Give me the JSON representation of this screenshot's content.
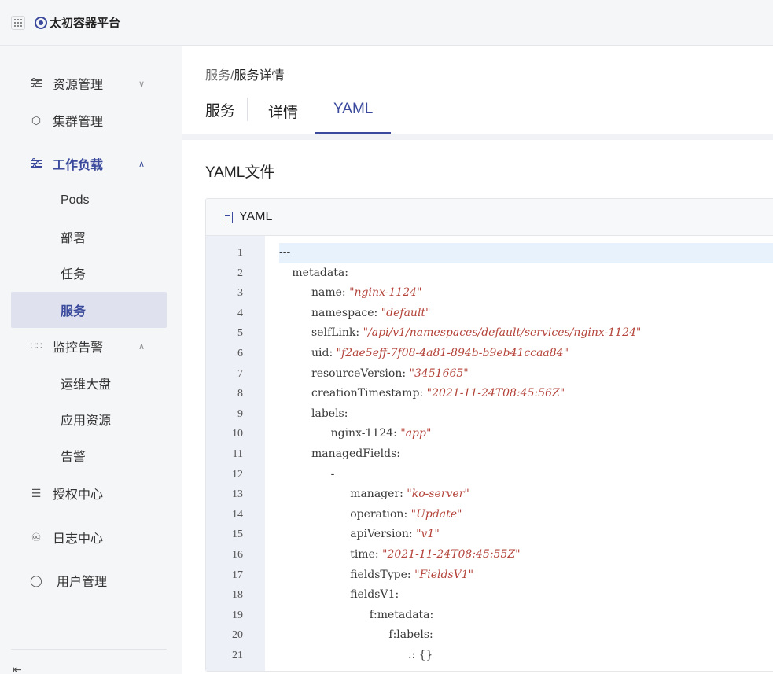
{
  "app": {
    "title": "太初容器平台"
  },
  "sidebar": {
    "items": [
      {
        "label": "资源管理",
        "icon": "sliders-icon",
        "expanded": false
      },
      {
        "label": "集群管理",
        "icon": "cluster-icon"
      },
      {
        "label": "工作负载",
        "icon": "sliders-icon",
        "expanded": true,
        "children": [
          {
            "label": "Pods"
          },
          {
            "label": "部署"
          },
          {
            "label": "任务"
          },
          {
            "label": "服务",
            "active": true
          }
        ]
      },
      {
        "label": "监控告警",
        "icon": "apps-icon",
        "expanded": true,
        "children": [
          {
            "label": "运维大盘"
          },
          {
            "label": "应用资源"
          },
          {
            "label": "告警"
          }
        ]
      },
      {
        "label": "授权中心",
        "icon": "list-icon"
      },
      {
        "label": "日志中心",
        "icon": "bell-icon"
      },
      {
        "label": "用户管理",
        "icon": "user-icon"
      }
    ]
  },
  "breadcrumb": {
    "parent": "服务",
    "separator": "/",
    "current": "服务详情"
  },
  "tabs": {
    "title": "服务",
    "items": [
      {
        "label": "详情"
      },
      {
        "label": "YAML",
        "active": true
      }
    ]
  },
  "section": {
    "title": "YAML文件"
  },
  "yaml_panel": {
    "label": "YAML"
  },
  "yaml_lines": [
    {
      "n": "1",
      "indent": 0,
      "key": "---",
      "val": ""
    },
    {
      "n": "2",
      "indent": 2,
      "key": "metadata:",
      "val": ""
    },
    {
      "n": "3",
      "indent": 5,
      "key": "name: ",
      "val": "\"nginx-1124\""
    },
    {
      "n": "4",
      "indent": 5,
      "key": "namespace: ",
      "val": "\"default\""
    },
    {
      "n": "5",
      "indent": 5,
      "key": "selfLink: ",
      "val": "\"/api/v1/namespaces/default/services/nginx-1124\""
    },
    {
      "n": "6",
      "indent": 5,
      "key": "uid: ",
      "val": "\"f2ae5eff-7f08-4a81-894b-b9eb41ccaa84\""
    },
    {
      "n": "7",
      "indent": 5,
      "key": "resourceVersion: ",
      "val": "\"3451665\""
    },
    {
      "n": "8",
      "indent": 5,
      "key": "creationTimestamp: ",
      "val": "\"2021-11-24T08:45:56Z\""
    },
    {
      "n": "9",
      "indent": 5,
      "key": "labels:",
      "val": ""
    },
    {
      "n": "10",
      "indent": 8,
      "key": "nginx-1124: ",
      "val": "\"app\""
    },
    {
      "n": "11",
      "indent": 5,
      "key": "managedFields:",
      "val": ""
    },
    {
      "n": "12",
      "indent": 8,
      "key": "-",
      "val": ""
    },
    {
      "n": "13",
      "indent": 11,
      "key": "manager: ",
      "val": "\"ko-server\""
    },
    {
      "n": "14",
      "indent": 11,
      "key": "operation: ",
      "val": "\"Update\""
    },
    {
      "n": "15",
      "indent": 11,
      "key": "apiVersion: ",
      "val": "\"v1\""
    },
    {
      "n": "16",
      "indent": 11,
      "key": "time: ",
      "val": "\"2021-11-24T08:45:55Z\""
    },
    {
      "n": "17",
      "indent": 11,
      "key": "fieldsType: ",
      "val": "\"FieldsV1\""
    },
    {
      "n": "18",
      "indent": 11,
      "key": "fieldsV1:",
      "val": ""
    },
    {
      "n": "19",
      "indent": 14,
      "key": "f:metadata:",
      "val": ""
    },
    {
      "n": "20",
      "indent": 17,
      "key": "f:labels:",
      "val": ""
    },
    {
      "n": "21",
      "indent": 20,
      "key": ".: {}",
      "val": ""
    }
  ]
}
